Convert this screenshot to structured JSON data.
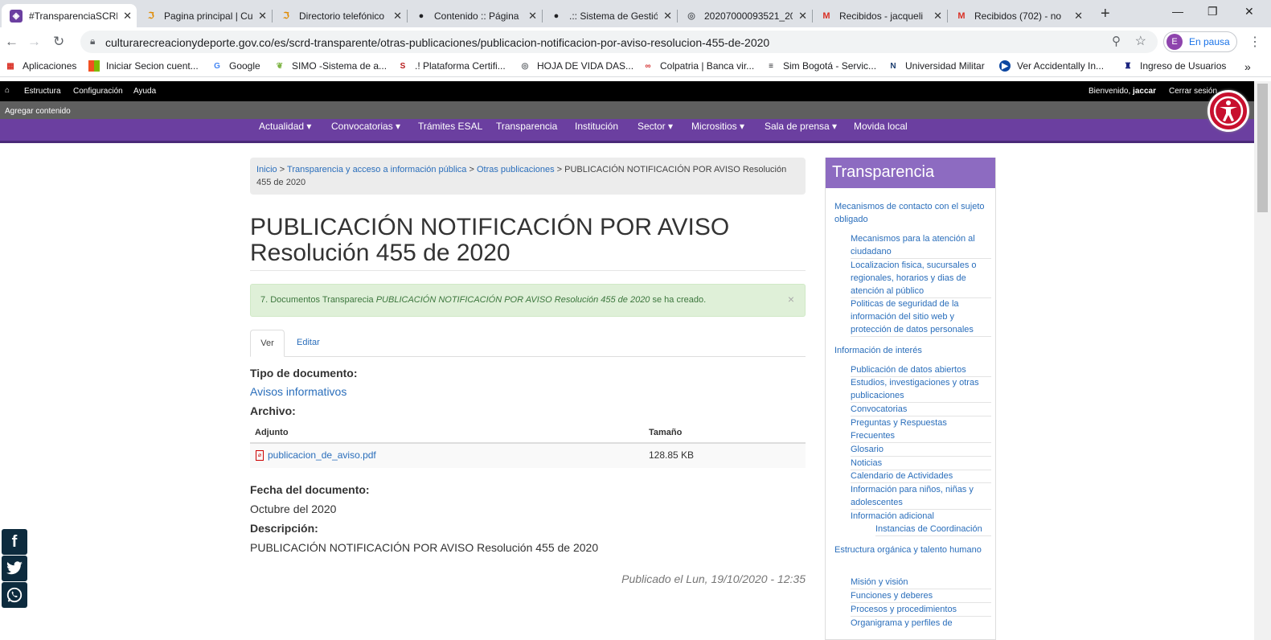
{
  "browser": {
    "tabs": [
      {
        "title": "#TransparenciaSCRD"
      },
      {
        "title": "Pagina principal | Cu"
      },
      {
        "title": "Directorio telefónico"
      },
      {
        "title": "Contenido :: Página"
      },
      {
        "title": ".:: Sistema de Gestió"
      },
      {
        "title": "20207000093521_20"
      },
      {
        "title": "Recibidos - jacqueli"
      },
      {
        "title": "Recibidos (702) - no"
      }
    ],
    "url": "culturarecreacionydeporte.gov.co/es/scrd-transparente/otras-publicaciones/publicacion-notificacion-por-aviso-resolucion-455-de-2020",
    "profile_initial": "E",
    "profile_label": "En pausa",
    "bookmarks": [
      {
        "label": "Aplicaciones"
      },
      {
        "label": "Iniciar Secion cuent..."
      },
      {
        "label": "Google"
      },
      {
        "label": "SIMO -Sistema de a..."
      },
      {
        "label": ".! Plataforma Certifi..."
      },
      {
        "label": "HOJA DE VIDA DAS..."
      },
      {
        "label": "Colpatria | Banca vir..."
      },
      {
        "label": "Sim Bogotá - Servic..."
      },
      {
        "label": "Universidad Militar"
      },
      {
        "label": "Ver Accidentally In..."
      },
      {
        "label": "Ingreso de Usuarios"
      }
    ]
  },
  "admin": {
    "structure": "Estructura",
    "config": "Configuración",
    "help": "Ayuda",
    "welcome": "Bienvenido,",
    "user": "jaccar",
    "logout": "Cerrar sesión",
    "add_content": "Agregar contenido"
  },
  "nav": [
    {
      "label": "Actualidad ▾"
    },
    {
      "label": "Convocatorias ▾"
    },
    {
      "label": "Trámites ESAL"
    },
    {
      "label": "Transparencia"
    },
    {
      "label": "Institución"
    },
    {
      "label": "Sector ▾"
    },
    {
      "label": "Micrositios ▾"
    },
    {
      "label": "Sala de prensa ▾"
    },
    {
      "label": "Movida local"
    }
  ],
  "breadcrumb": {
    "home": "Inicio",
    "sep": ">",
    "level1": "Transparencia y acceso a información pública",
    "level2": "Otras publicaciones",
    "current": "PUBLICACIÓN NOTIFICACIÓN POR AVISO Resolución 455 de 2020"
  },
  "page": {
    "title": "PUBLICACIÓN NOTIFICACIÓN POR AVISO Resolución 455 de 2020",
    "alert_prefix": "7. Documentos Transparecia",
    "alert_item": "PUBLICACIÓN NOTIFICACIÓN POR AVISO Resolución 455 de 2020",
    "alert_suffix": "se ha creado.",
    "alert_close": "×",
    "tab_view": "Ver",
    "tab_edit": "Editar",
    "doc_type_label": "Tipo de documento:",
    "doc_type_value": "Avisos informativos",
    "file_label": "Archivo:",
    "col_attach": "Adjunto",
    "col_size": "Tamaño",
    "file_name": "publicacion_de_aviso.pdf",
    "file_size": "128.85 KB",
    "date_label": "Fecha del documento:",
    "date_value": "Octubre del 2020",
    "desc_label": "Descripción:",
    "desc_value": "PUBLICACIÓN NOTIFICACIÓN POR AVISO Resolución 455 de 2020",
    "published": "Publicado el Lun, 19/10/2020 - 12:35"
  },
  "sidebar": {
    "title": "Transparencia",
    "links": [
      {
        "text": "Mecanismos de contacto con el sujeto obligado"
      },
      {
        "text": "Mecanismos para la atención al ciudadano"
      },
      {
        "text": "Localizacion fisica, sucursales o regionales, horarios y dias de atención al público"
      },
      {
        "text": "Politicas de seguridad de la información del sitio web y protección de datos personales"
      },
      {
        "text": "Información de interés"
      },
      {
        "text": "Publicación de datos abiertos"
      },
      {
        "text": "Estudios, investigaciones y otras publicaciones"
      },
      {
        "text": "Convocatorias"
      },
      {
        "text": "Preguntas y Respuestas Frecuentes"
      },
      {
        "text": "Glosario"
      },
      {
        "text": "Noticias"
      },
      {
        "text": "Calendario de Actividades"
      },
      {
        "text": "Información para niños, niñas y adolescentes"
      },
      {
        "text": "Información adicional"
      },
      {
        "text": "Instancias de Coordinación"
      },
      {
        "text": "Estructura orgánica y talento humano"
      },
      {
        "text": "Misión y visión"
      },
      {
        "text": "Funciones y deberes"
      },
      {
        "text": "Procesos y procedimientos"
      },
      {
        "text": "Organigrama y perfiles de"
      }
    ]
  },
  "colors": {
    "purple_nav": "#6b3fa0",
    "sidebar_head": "#8d6bc1",
    "link": "#2a6ebb",
    "alert_bg": "#dff0d8"
  }
}
